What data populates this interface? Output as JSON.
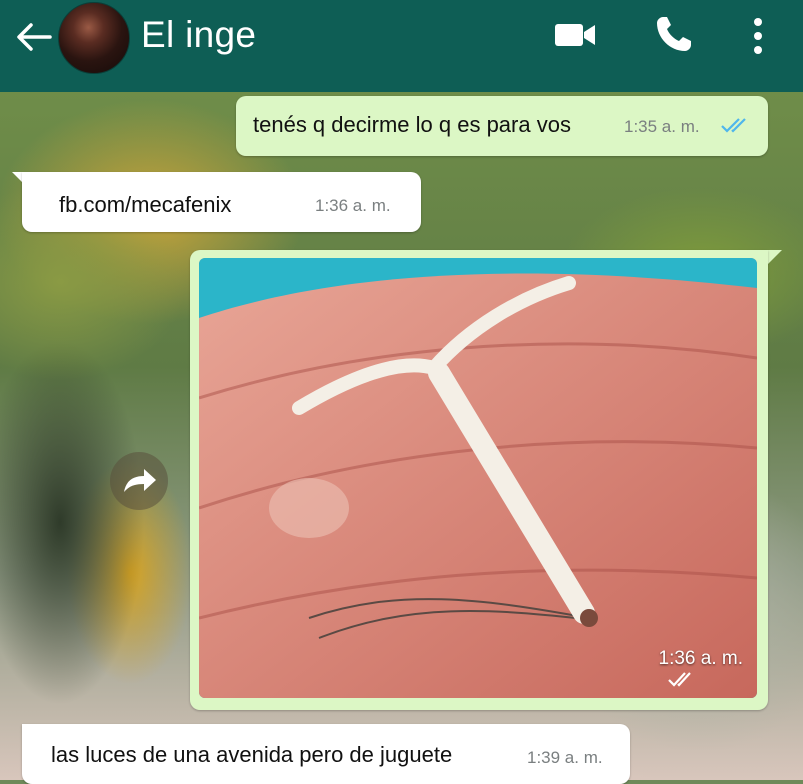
{
  "header": {
    "contact_name": "El inge",
    "back_icon": "arrow-left-icon",
    "video_icon": "video-camera-icon",
    "phone_icon": "phone-icon",
    "menu_icon": "more-vertical-icon",
    "background_color": "#0e5e55"
  },
  "messages": [
    {
      "direction": "outgoing",
      "text": "tenés q decirme lo q es para vos",
      "time": "1:35 a. m.",
      "status": "read"
    },
    {
      "direction": "incoming",
      "text": "fb.com/mecafenix",
      "time": "1:36 a. m."
    },
    {
      "direction": "outgoing",
      "type": "image",
      "time": "1:36 a. m.",
      "status": "read"
    },
    {
      "direction": "incoming",
      "text": "las luces de una avenida pero de juguete",
      "time": "1:39 a. m."
    }
  ],
  "colors": {
    "outgoing_bubble": "#dcf7c5",
    "incoming_bubble": "#ffffff",
    "read_ticks": "#4fb6ec"
  }
}
